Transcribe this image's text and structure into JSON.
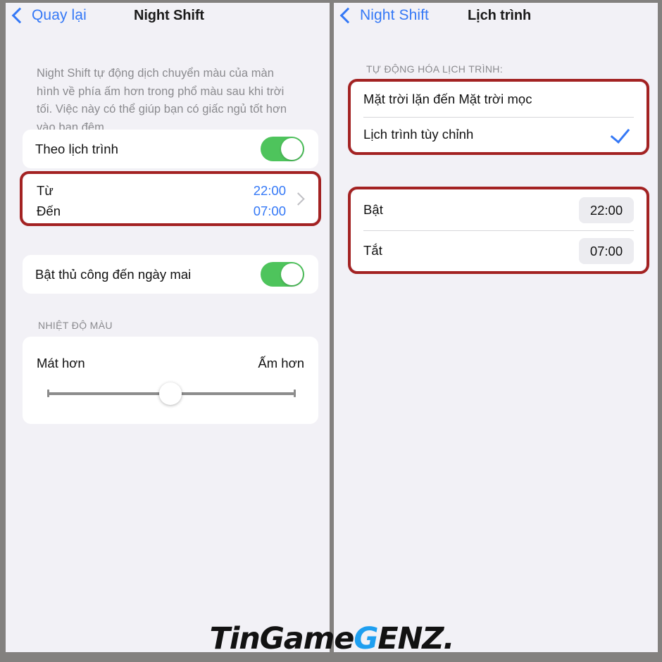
{
  "left_panel": {
    "nav": {
      "back_label": "Quay lại",
      "back_icon": "chevron-left-icon",
      "title": "Night Shift"
    },
    "description": "Night Shift tự động dịch chuyển màu của màn hình về phía ấm hơn trong phổ màu sau khi trời tối. Việc này có thể giúp bạn có giấc ngủ tốt hơn vào ban đêm.",
    "schedule_row": {
      "label": "Theo lịch trình",
      "toggle_state": "on"
    },
    "time_rows": {
      "from_label": "Từ",
      "from_value": "22:00",
      "to_label": "Đến",
      "to_value": "07:00",
      "disclosure_icon": "chevron-right-icon",
      "highlighted": true
    },
    "manual_row": {
      "label": "Bật thủ công đến ngày mai",
      "toggle_state": "on"
    },
    "temperature": {
      "group_header": "NHIỆT ĐỘ MÀU",
      "cooler_label": "Mát hơn",
      "warmer_label": "Ấm hơn",
      "slider_value_percent": 50
    }
  },
  "right_panel": {
    "nav": {
      "back_label": "Night Shift",
      "back_icon": "chevron-left-icon",
      "title": "Lịch trình"
    },
    "automation": {
      "group_header": "TỰ ĐỘNG HÓA LỊCH TRÌNH:",
      "options": [
        {
          "label": "Mặt trời lặn đến Mặt trời mọc",
          "selected": false
        },
        {
          "label": "Lịch trình tùy chỉnh",
          "selected": true
        }
      ],
      "selected_icon": "checkmark-icon",
      "highlighted": true
    },
    "times": {
      "rows": [
        {
          "label": "Bật",
          "value": "22:00"
        },
        {
          "label": "Tắt",
          "value": "07:00"
        }
      ],
      "highlighted": true
    }
  },
  "watermark": {
    "part1": "TinGame",
    "part2": "G",
    "part3": "ENZ."
  },
  "colors": {
    "background": "#f2f1f6",
    "card": "#ffffff",
    "accent_blue": "#3478f6",
    "toggle_green": "#4ec45c",
    "annotation_red": "#a32222",
    "frame_gray": "#83817f",
    "muted_text": "#8a8a8e",
    "badge_gray": "#ececf0",
    "watermark_blue": "#1f9ff0"
  }
}
